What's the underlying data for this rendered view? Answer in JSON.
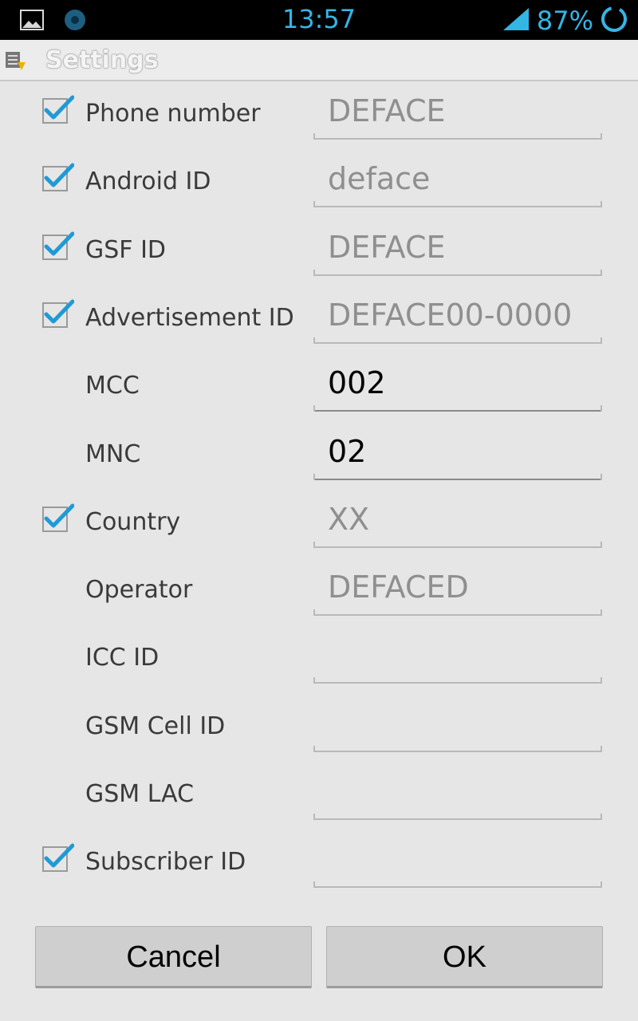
{
  "status_bar": {
    "time": "13:57",
    "battery": "87%",
    "icons": [
      "image-icon",
      "app-circle-icon",
      "signal-icon",
      "battery-ring-icon"
    ],
    "accent_color": "#33b5e5"
  },
  "title_bar": {
    "title": "Settings",
    "icon": "settings-list-icon"
  },
  "fields": [
    {
      "label": "Phone number",
      "checked": true,
      "text": "DEFACE",
      "is_hint": true
    },
    {
      "label": "Android ID",
      "checked": true,
      "text": "deface",
      "is_hint": true
    },
    {
      "label": "GSF ID",
      "checked": true,
      "text": "DEFACE",
      "is_hint": true
    },
    {
      "label": "Advertisement ID",
      "checked": true,
      "text": "DEFACE00-0000",
      "is_hint": true
    },
    {
      "label": "MCC",
      "checked": false,
      "text": "002",
      "is_hint": false
    },
    {
      "label": "MNC",
      "checked": false,
      "text": "02",
      "is_hint": false
    },
    {
      "label": "Country",
      "checked": true,
      "text": "XX",
      "is_hint": true
    },
    {
      "label": "Operator",
      "checked": false,
      "text": "DEFACED",
      "is_hint": true
    },
    {
      "label": "ICC ID",
      "checked": false,
      "text": "",
      "is_hint": true
    },
    {
      "label": "GSM Cell ID",
      "checked": false,
      "text": "",
      "is_hint": true
    },
    {
      "label": "GSM LAC",
      "checked": false,
      "text": "",
      "is_hint": true
    },
    {
      "label": "Subscriber ID",
      "checked": true,
      "text": "",
      "is_hint": true
    }
  ],
  "buttons": {
    "cancel": "Cancel",
    "ok": "OK"
  }
}
